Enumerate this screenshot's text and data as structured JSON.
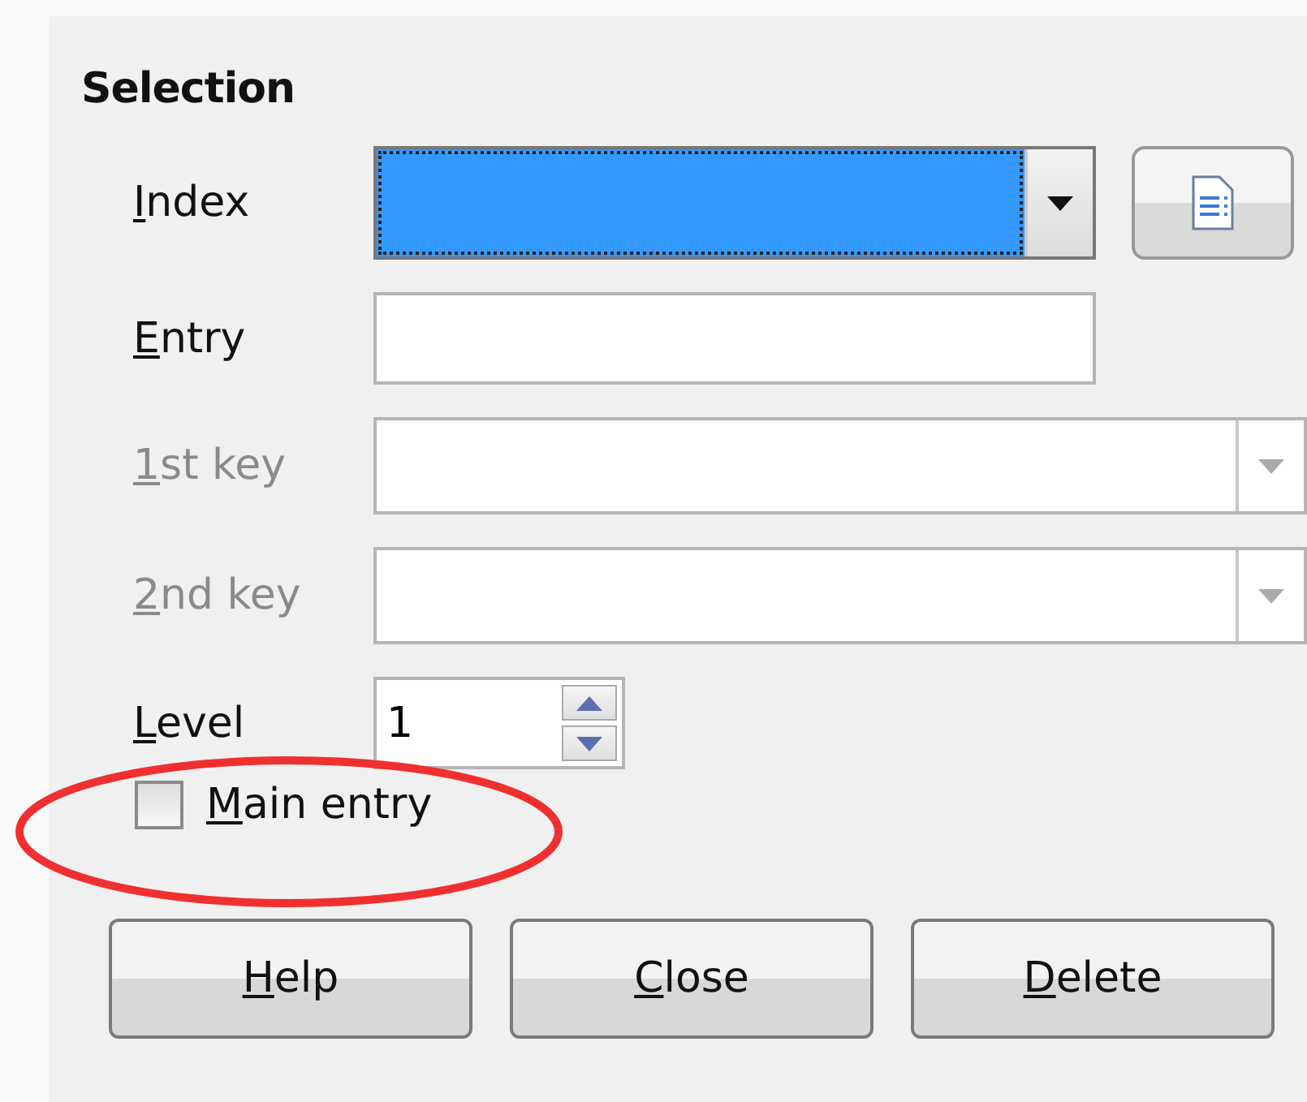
{
  "section": {
    "title": "Selection"
  },
  "fields": [
    {
      "kind": "combo",
      "label": "Index",
      "focused": true,
      "disabled": false,
      "has_button": true
    },
    {
      "kind": "text",
      "label": "Entry",
      "disabled": false
    },
    {
      "kind": "combo",
      "label": "1st key",
      "focused": false,
      "disabled": true,
      "wide": true
    },
    {
      "kind": "combo",
      "label": "2nd key",
      "focused": false,
      "disabled": true,
      "wide": true
    },
    {
      "kind": "spin",
      "label": "Level",
      "value": "1",
      "disabled": false
    }
  ],
  "main_entry": {
    "label": "Main entry",
    "checked": false,
    "highlighted": true
  },
  "buttons": [
    "Help",
    "Close",
    "Delete"
  ]
}
